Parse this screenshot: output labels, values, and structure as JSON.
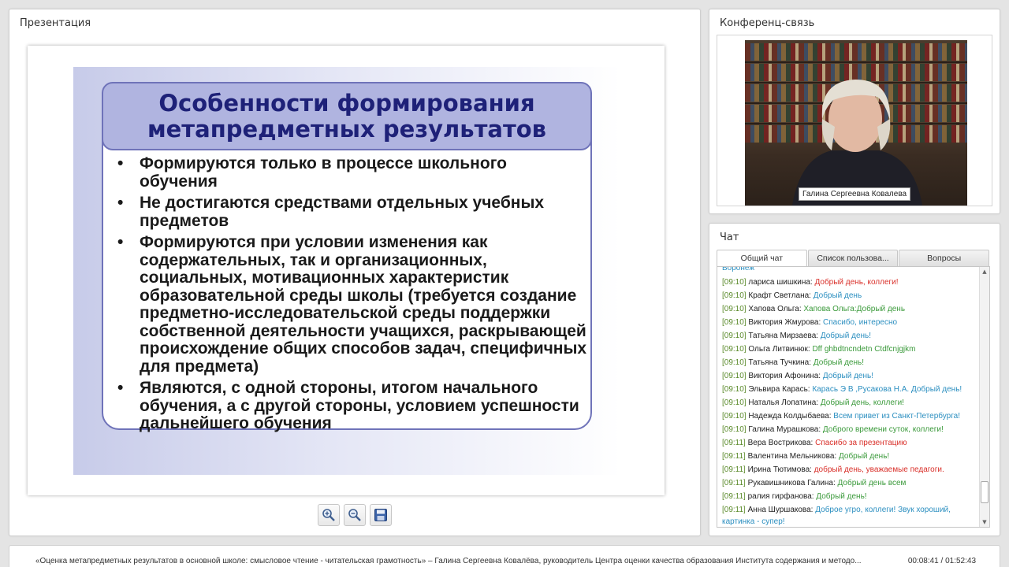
{
  "presentation": {
    "panel_title": "Презентация",
    "slide": {
      "title_line1": "Особенности формирования",
      "title_line2": "метапредметных результатов",
      "bullets": [
        "Формируются только в процессе школьного обучения",
        "Не достигаются средствами отдельных учебных предметов",
        "Формируются при условии изменения  как содержательных, так и организационных, социальных, мотивационных характеристик образовательной среды школы (требуется создание предметно-исследовательской среды поддержки собственной деятельности учащихся, раскрывающей происхождение общих способов задач, специфичных для предмета)",
        "Являются, с одной стороны, итогом начального обучения, а с другой стороны, условием успешности дальнейшего обучения"
      ]
    },
    "toolbar": {
      "zoom_in_icon": "zoom-in-icon",
      "zoom_out_icon": "zoom-out-icon",
      "save_icon": "save-icon"
    }
  },
  "conference": {
    "panel_title": "Конференц-связь",
    "speaker_name": "Галина Сергеевна Ковалева"
  },
  "chat": {
    "panel_title": "Чат",
    "tabs": [
      "Общий чат",
      "Список пользова...",
      "Вопросы"
    ],
    "active_tab": 0,
    "partial_top_text": "Воронеж",
    "messages": [
      {
        "time": "[09:10]",
        "name": "лариса шишкина:",
        "text": "Добрый день, коллеги!",
        "color": "#d9302a"
      },
      {
        "time": "[09:10]",
        "name": "Крафт Светлана:",
        "text": "Добрый день",
        "color": "#2c8fc0"
      },
      {
        "time": "[09:10]",
        "name": "Хапова Ольга:",
        "text": "Хапова Ольга:Добрый день",
        "color": "#3b9a3b"
      },
      {
        "time": "[09:10]",
        "name": "Виктория Жмурова:",
        "text": "Спасибо, интересно",
        "color": "#2c8fc0"
      },
      {
        "time": "[09:10]",
        "name": "Татьяна Мирзаева:",
        "text": "Добрый день!",
        "color": "#2c8fc0"
      },
      {
        "time": "[09:10]",
        "name": "Ольга Литвинюк:",
        "text": "Dff ghbdtncndetn Ctdfcnjgjkm",
        "color": "#3b9a3b"
      },
      {
        "time": "[09:10]",
        "name": "Татьяна Тучкина:",
        "text": "Добрый день!",
        "color": "#3b9a3b"
      },
      {
        "time": "[09:10]",
        "name": "Виктория Афонина:",
        "text": "Добрый день!",
        "color": "#2c8fc0"
      },
      {
        "time": "[09:10]",
        "name": "Эльвира Карась:",
        "text": "Карась Э В ,Русакова Н.А. Добрый день!",
        "color": "#2c8fc0"
      },
      {
        "time": "[09:10]",
        "name": "Наталья Лопатина:",
        "text": "Добрый день, коллеги!",
        "color": "#3b9a3b"
      },
      {
        "time": "[09:10]",
        "name": "Надежда Колдыбаева:",
        "text": "Всем привет из Санкт-Петербурга!",
        "color": "#2c8fc0"
      },
      {
        "time": "[09:10]",
        "name": "Галина Мурашкова:",
        "text": "Доброго времени суток, коллеги!",
        "color": "#3b9a3b"
      },
      {
        "time": "[09:11]",
        "name": "Вера Вострикова:",
        "text": "Спасибо за презентацию",
        "color": "#d9302a"
      },
      {
        "time": "[09:11]",
        "name": "Валентина Мельникова:",
        "text": "Добрый день!",
        "color": "#3b9a3b"
      },
      {
        "time": "[09:11]",
        "name": "Ирина Тютимова:",
        "text": "добрый день, уважаемые педагоги.",
        "color": "#d9302a"
      },
      {
        "time": "[09:11]",
        "name": "Рукавишникова Галина:",
        "text": "Добрый день всем",
        "color": "#3b9a3b"
      },
      {
        "time": "[09:11]",
        "name": "ралия гирфанова:",
        "text": "Добрый день!",
        "color": "#3b9a3b"
      },
      {
        "time": "[09:11]",
        "name": "Анна Шуршакова:",
        "text": "Доброе угро, коллеги! Звук хороший, картинка - супер!",
        "color": "#2c8fc0"
      }
    ]
  },
  "footer": {
    "title": "«Оценка метапредметных результатов в основной школе: смысловое чтение - читательская грамотность» – Галина Сергеевна Ковалёва, руководитель Центра оценки качества образования Института содержания и методо...",
    "time": "00:08:41 / 01:52:43"
  }
}
